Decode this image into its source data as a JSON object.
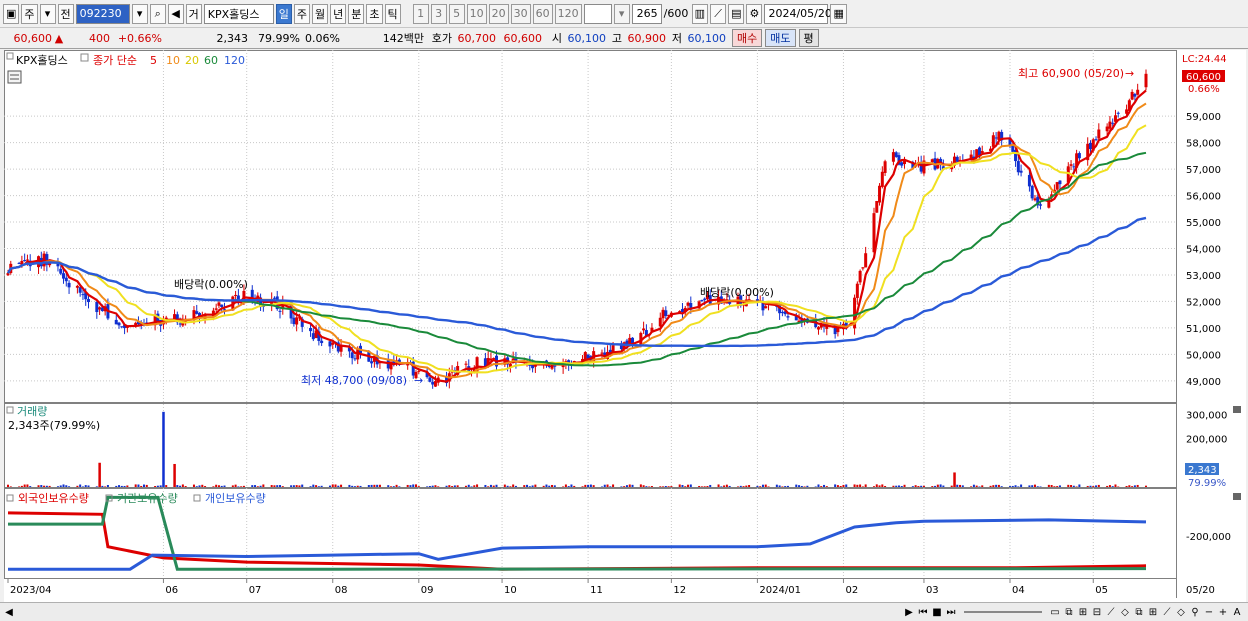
{
  "toolbar": {
    "market": "주",
    "prev_label": "전",
    "code": "092230",
    "trade_label": "거",
    "name": "KPX홀딩스",
    "periods": [
      "일",
      "주",
      "월",
      "년",
      "분",
      "초",
      "틱"
    ],
    "active_period": "일",
    "multipliers": [
      "1",
      "3",
      "5",
      "10",
      "20",
      "30",
      "60",
      "120"
    ],
    "count": "265",
    "total": "/600",
    "date": "2024/05/20"
  },
  "quote": {
    "price": "60,600",
    "change": "400",
    "change_pct": "+0.66%",
    "volume": "2,343",
    "vol_ratio": "79.99%",
    "turnover": "0.06%",
    "amount": "142백만",
    "bid_label": "호가",
    "bid1": "60,700",
    "bid2": "60,600",
    "open_label": "시",
    "open": "60,100",
    "high_label": "고",
    "high": "60,900",
    "low_label": "저",
    "low": "60,100",
    "buy": "매수",
    "sell": "매도",
    "avg": "평"
  },
  "price_panel": {
    "title": "KPX홀딩스",
    "legend_lead": "종가 단순",
    "ma_names": [
      "5",
      "10",
      "20",
      "60",
      "120"
    ],
    "ma_colors": [
      "#dd0000",
      "#f08a18",
      "#f0e020",
      "#1a8a3a",
      "#2a5ad8"
    ],
    "lc_label": "LC:24.44",
    "cur_price": "60,600",
    "cur_pct": "0.66%",
    "high_annot": "최고 60,900 (05/20)",
    "low_annot": "최저 48,700 (09/08)",
    "div1": "배당락(0.00%)",
    "div2": "배당락(0.00%)"
  },
  "volume_panel": {
    "title": "거래량",
    "readout": "2,343주(79.99%)",
    "cur_value": "2,343",
    "cur_pct": "79.99%"
  },
  "holdings_panel": {
    "titles": [
      "외국인보유수량",
      "기관보유수량",
      "개인보유수량"
    ],
    "colors": [
      "#dd0000",
      "#2a8a5a",
      "#2a5ad8"
    ],
    "tick": "-200,000"
  },
  "colors": {
    "up": "#dd0000",
    "down": "#1030d0",
    "bg": "#ffffff",
    "grid": "#c8c8c8"
  },
  "chart_data": [
    {
      "type": "candlestick",
      "title": "KPX홀딩스",
      "x_labels": [
        "2023/04",
        "06",
        "07",
        "08",
        "09",
        "10",
        "11",
        "12",
        "2024/01",
        "02",
        "03",
        "04",
        "05"
      ],
      "x_range": [
        "2023/04/06",
        "2024/05/20"
      ],
      "y_ticks": [
        49000,
        50000,
        51000,
        52000,
        53000,
        54000,
        55000,
        56000,
        57000,
        58000,
        59000
      ],
      "ylim": [
        48200,
        61500
      ],
      "series": [
        {
          "name": "종가",
          "type": "close",
          "x": [
            "2023/04/06",
            "2023/04/20",
            "2023/05/04",
            "2023/05/18",
            "2023/06/01",
            "2023/06/15",
            "2023/06/29",
            "2023/07/13",
            "2023/07/27",
            "2023/08/10",
            "2023/08/24",
            "2023/09/08",
            "2023/09/22",
            "2023/10/06",
            "2023/10/20",
            "2023/11/03",
            "2023/11/17",
            "2023/12/01",
            "2023/12/15",
            "2023/12/29",
            "2024/01/12",
            "2024/01/26",
            "2024/02/02",
            "2024/02/08",
            "2024/02/16",
            "2024/03/01",
            "2024/03/15",
            "2024/03/29",
            "2024/04/12",
            "2024/04/26",
            "2024/05/10",
            "2024/05/20"
          ],
          "y": [
            53200,
            53600,
            52000,
            51200,
            51300,
            51500,
            52200,
            51800,
            50600,
            50000,
            49600,
            49000,
            49700,
            49700,
            49600,
            50000,
            50500,
            51700,
            52100,
            52000,
            51500,
            51000,
            51000,
            53500,
            57500,
            57100,
            57300,
            58300,
            55500,
            57500,
            59000,
            60600
          ]
        },
        {
          "name": "5",
          "y_note": "5-day simple moving average of close"
        },
        {
          "name": "10",
          "y_note": "10-day simple moving average of close"
        },
        {
          "name": "20",
          "y_note": "20-day simple moving average of close"
        },
        {
          "name": "60",
          "y_note": "60-day simple moving average of close"
        },
        {
          "name": "120",
          "y_note": "120-day simple moving average of close"
        }
      ]
    },
    {
      "type": "bar",
      "title": "거래량",
      "y_ticks": [
        200000,
        300000
      ],
      "ylim": [
        0,
        330000
      ],
      "peaks": [
        {
          "x": "2023/05/09",
          "value": 100000
        },
        {
          "x": "2023/06/01",
          "value": 310000
        },
        {
          "x": "2023/06/05",
          "value": 95000
        },
        {
          "x": "2024/03/12",
          "value": 60000
        }
      ],
      "last": 2343
    },
    {
      "type": "line",
      "title": "보유수량",
      "y_ticks": [
        -200000
      ],
      "series": [
        {
          "name": "외국인보유수량",
          "points": [
            [
              "2023/04/06",
              -90000
            ],
            [
              "2023/05/10",
              -95000
            ],
            [
              "2023/05/12",
              -210000
            ],
            [
              "2023/06/01",
              -250000
            ],
            [
              "2023/07/01",
              -265000
            ],
            [
              "2023/09/01",
              -275000
            ],
            [
              "2023/10/01",
              -290000
            ],
            [
              "2024/01/01",
              -285000
            ],
            [
              "2024/04/01",
              -285000
            ],
            [
              "2024/05/20",
              -278000
            ]
          ]
        },
        {
          "name": "기관보유수량",
          "points": [
            [
              "2023/04/06",
              -130000
            ],
            [
              "2023/05/10",
              -130000
            ],
            [
              "2023/05/12",
              -35000
            ],
            [
              "2023/05/30",
              -35000
            ],
            [
              "2023/06/06",
              -290000
            ],
            [
              "2023/08/01",
              -290000
            ],
            [
              "2024/05/20",
              -288000
            ]
          ]
        },
        {
          "name": "개인보유수량",
          "points": [
            [
              "2023/04/06",
              -290000
            ],
            [
              "2023/05/20",
              -290000
            ],
            [
              "2023/05/28",
              -240000
            ],
            [
              "2023/07/01",
              -245000
            ],
            [
              "2023/08/01",
              -240000
            ],
            [
              "2023/09/01",
              -235000
            ],
            [
              "2023/09/08",
              -255000
            ],
            [
              "2023/10/01",
              -215000
            ],
            [
              "2023/11/01",
              -210000
            ],
            [
              "2024/01/01",
              -210000
            ],
            [
              "2024/01/20",
              -200000
            ],
            [
              "2024/02/05",
              -140000
            ],
            [
              "2024/02/20",
              -125000
            ],
            [
              "2024/03/01",
              -120000
            ],
            [
              "2024/04/15",
              -115000
            ],
            [
              "2024/05/20",
              -122000
            ]
          ]
        }
      ]
    }
  ]
}
